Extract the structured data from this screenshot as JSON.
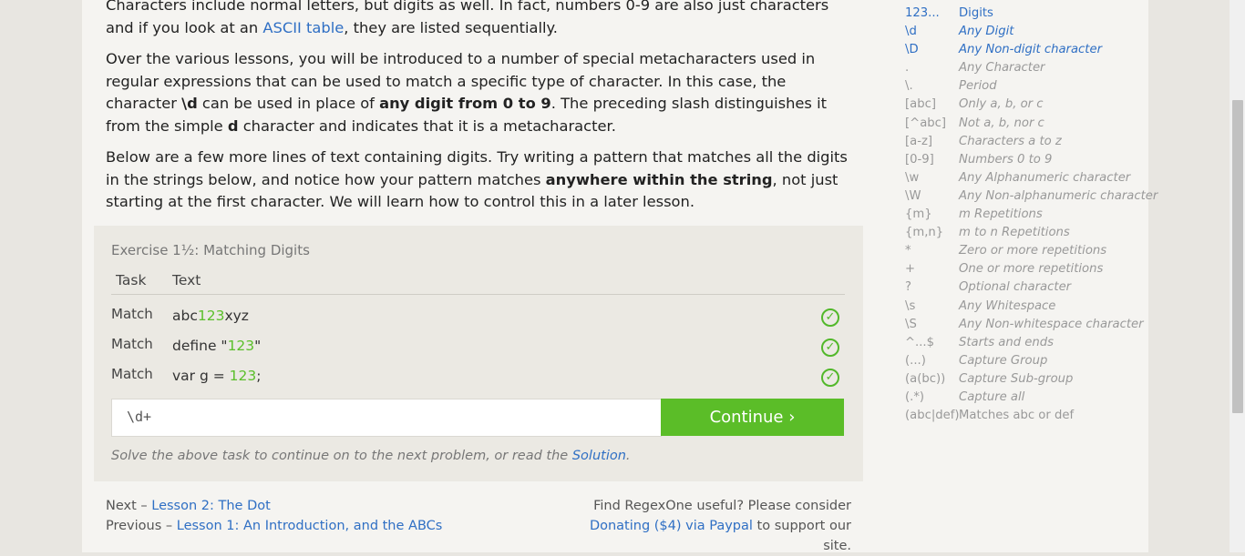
{
  "lesson": {
    "p1_text_a": "Characters include normal letters, but digits as well. In fact, numbers 0-9 are also just characters and if you look at an ",
    "p1_link": "ASCII table",
    "p1_text_b": ", they are listed sequentially.",
    "p2_a": "Over the various lessons, you will be introduced to a number of special metacharacters used in regular expressions that can be used to match a specific type of character. In this case, the character ",
    "p2_b": "\\d",
    "p2_c": " can be used in place of ",
    "p2_d": "any digit from 0 to 9",
    "p2_e": ". The preceding slash distinguishes it from the simple ",
    "p2_f": "d",
    "p2_g": " character and indicates that it is a metacharacter.",
    "p3_a": "Below are a few more lines of text containing digits. Try writing a pattern that matches all the digits in the strings below, and notice how your pattern matches ",
    "p3_b": "anywhere within the string",
    "p3_c": ", not just starting at the first character. We will learn how to control this in a later lesson."
  },
  "exercise": {
    "title": "Exercise 1½: Matching Digits",
    "col_task": "Task",
    "col_text": "Text",
    "rows": [
      {
        "task": "Match",
        "pre": "abc",
        "hl": "123",
        "post": "xyz"
      },
      {
        "task": "Match",
        "pre": "define \"",
        "hl": "123",
        "post": "\""
      },
      {
        "task": "Match",
        "pre": "var g = ",
        "hl": "123",
        "post": ";"
      }
    ],
    "input_value": "\\d+",
    "continue_label": "Continue ›",
    "hint_a": "Solve the above task to continue on to the next problem, or read the ",
    "hint_link": "Solution",
    "hint_b": "."
  },
  "footer": {
    "next_prefix": "Next – ",
    "next_link": "Lesson 2: The Dot",
    "prev_prefix": "Previous – ",
    "prev_link": "Lesson 1: An Introduction, and the ABCs",
    "support_a": "Find RegexOne useful? Please consider",
    "support_link": "Donating ($4) via Paypal",
    "support_b": " to support our site."
  },
  "reference": [
    {
      "code": "123...",
      "desc": "Digits",
      "state": "active-plain"
    },
    {
      "code": "\\d",
      "desc": "Any Digit",
      "state": "active"
    },
    {
      "code": "\\D",
      "desc": "Any Non-digit character",
      "state": "active"
    },
    {
      "code": ".",
      "desc": "Any Character",
      "state": ""
    },
    {
      "code": "\\.",
      "desc": "Period",
      "state": ""
    },
    {
      "code": "[abc]",
      "desc": "Only a, b, or c",
      "state": ""
    },
    {
      "code": "[^abc]",
      "desc": "Not a, b, nor c",
      "state": ""
    },
    {
      "code": "[a-z]",
      "desc": "Characters a to z",
      "state": ""
    },
    {
      "code": "[0-9]",
      "desc": "Numbers 0 to 9",
      "state": ""
    },
    {
      "code": "\\w",
      "desc": "Any Alphanumeric character",
      "state": ""
    },
    {
      "code": "\\W",
      "desc": "Any Non-alphanumeric character",
      "state": ""
    },
    {
      "code": "{m}",
      "desc": "m Repetitions",
      "state": ""
    },
    {
      "code": "{m,n}",
      "desc": "m to n Repetitions",
      "state": ""
    },
    {
      "code": "*",
      "desc": "Zero or more repetitions",
      "state": ""
    },
    {
      "code": "+",
      "desc": "One or more repetitions",
      "state": ""
    },
    {
      "code": "?",
      "desc": "Optional character",
      "state": ""
    },
    {
      "code": "\\s",
      "desc": "Any Whitespace",
      "state": ""
    },
    {
      "code": "\\S",
      "desc": "Any Non-whitespace character",
      "state": ""
    },
    {
      "code": "^...$",
      "desc": "Starts and ends",
      "state": ""
    },
    {
      "code": "(...)",
      "desc": "Capture Group",
      "state": ""
    },
    {
      "code": "(a(bc))",
      "desc": "Capture Sub-group",
      "state": ""
    },
    {
      "code": "(.*)",
      "desc": "Capture all",
      "state": ""
    },
    {
      "code": "(abc|def)",
      "desc": "Matches abc or def",
      "state": "plain"
    }
  ],
  "colors": {
    "accent": "#5bbd28",
    "link": "#2f6fc4",
    "highlight": "#5bbf2b"
  }
}
